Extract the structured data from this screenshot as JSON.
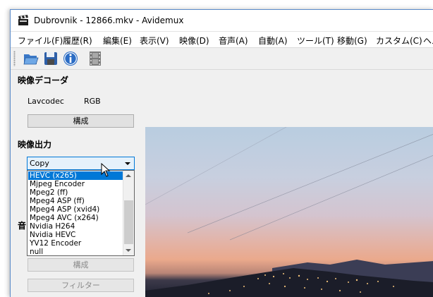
{
  "window": {
    "title": "Dubrovnik - 12866.mkv - Avidemux"
  },
  "menu": [
    "ファイル(F)",
    "履歴(R)",
    "編集(E)",
    "表示(V)",
    "映像(D)",
    "音声(A)",
    "自動(A)",
    "ツール(T)",
    "移動(G)",
    "カスタム(C)",
    "ヘル"
  ],
  "toolbar": {
    "icons": [
      "open-folder-icon",
      "save-floppy-icon",
      "info-icon",
      "film-strip-icon"
    ]
  },
  "video_decoder": {
    "title": "映像デコーダ",
    "decoder_name": "Lavcodec",
    "format": "RGB",
    "configure_label": "構成"
  },
  "video_output": {
    "title": "映像出力",
    "selected": "Copy",
    "options": [
      "HEVC (x265)",
      "Mjpeg Encoder",
      "Mpeg2 (ff)",
      "Mpeg4 ASP (ff)",
      "Mpeg4 ASP (xvid4)",
      "Mpeg4 AVC (x264)",
      "Nvidia H264",
      "Nvidia HEVC",
      "YV12 Encoder",
      "null"
    ],
    "highlighted_option": "HEVC (x265)"
  },
  "audio_output": {
    "title_visible_fragment": "音",
    "configure_label": "構成",
    "filter_label": "フィルター"
  },
  "colors": {
    "accent": "#0078d7",
    "selection": "#0078d7"
  }
}
